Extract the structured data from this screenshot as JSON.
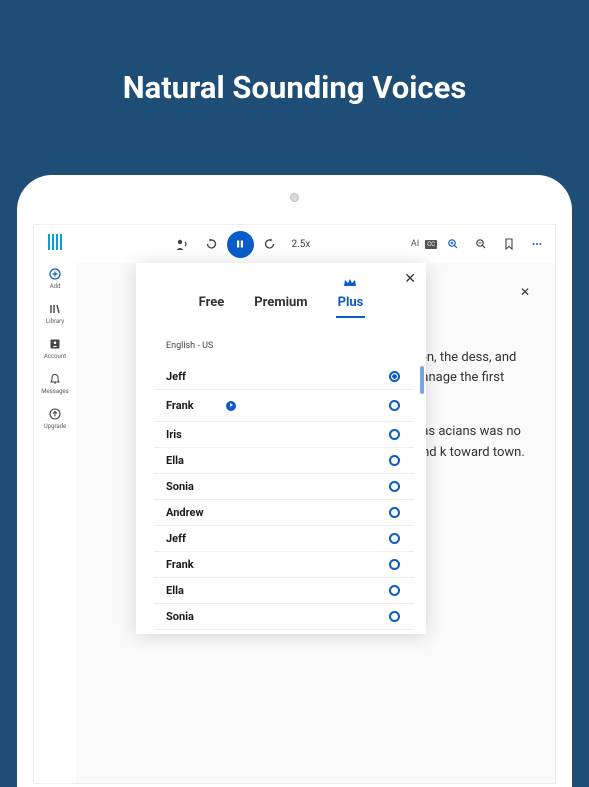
{
  "hero": {
    "title": "Natural Sounding Voices"
  },
  "sidebar": {
    "items": [
      {
        "name": "add",
        "label": "Add",
        "icon": "plus-circle",
        "blue": true
      },
      {
        "name": "library",
        "label": "Library",
        "icon": "books"
      },
      {
        "name": "account",
        "label": "Account",
        "icon": "user-box"
      },
      {
        "name": "messages",
        "label": "Messages",
        "icon": "bell"
      },
      {
        "name": "upgrade",
        "label": "Upgrade",
        "icon": "up-arrow-circle"
      }
    ]
  },
  "toolbar": {
    "speed": "2.5x",
    "ai_label": "AI"
  },
  "popup": {
    "tabs": [
      {
        "key": "free",
        "label": "Free",
        "active": false
      },
      {
        "key": "premium",
        "label": "Premium",
        "active": false
      },
      {
        "key": "plus",
        "label": "Plus",
        "active": true,
        "crown": true
      }
    ],
    "language": "English - US",
    "voices": [
      {
        "name": "Jeff",
        "selected": true,
        "playing": false
      },
      {
        "name": "Frank",
        "selected": false,
        "playing": true
      },
      {
        "name": "Iris",
        "selected": false,
        "playing": false
      },
      {
        "name": "Ella",
        "selected": false,
        "playing": false
      },
      {
        "name": "Sonia",
        "selected": false,
        "playing": false
      },
      {
        "name": "Andrew",
        "selected": false,
        "playing": false
      },
      {
        "name": "Jeff",
        "selected": false,
        "playing": false
      },
      {
        "name": "Frank",
        "selected": false,
        "playing": false
      },
      {
        "name": "Ella",
        "selected": false,
        "playing": false
      },
      {
        "name": "Sonia",
        "selected": false,
        "playing": false
      }
    ]
  },
  "background_text": {
    "p1": "n Glaucon, the dess, and also l manage the first time.",
    "p2": "dents was acians was no prayer and k toward town."
  }
}
